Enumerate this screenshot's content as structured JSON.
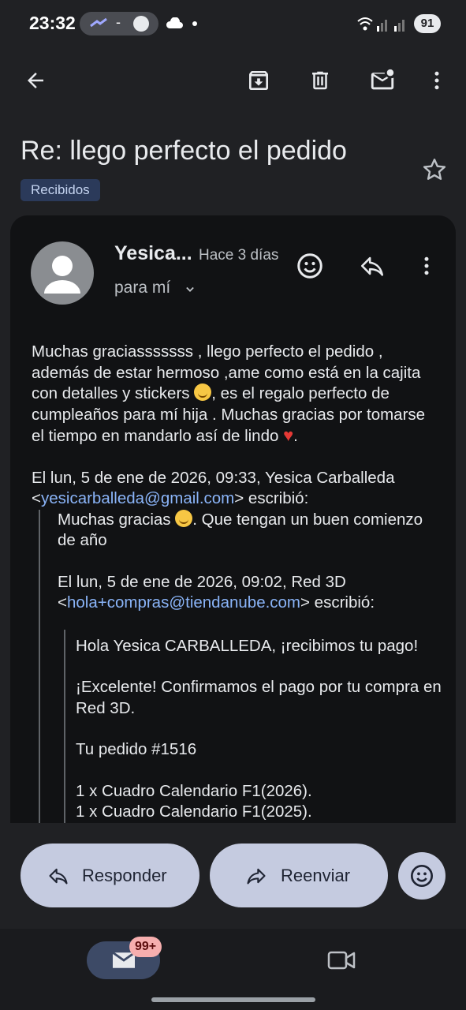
{
  "status": {
    "time": "23:32",
    "pill_dash": "-",
    "battery": "91"
  },
  "toolbar": {
    "back_icon": "arrow-back-icon",
    "archive_icon": "archive-icon",
    "delete_icon": "trash-icon",
    "unread_icon": "mark-unread-icon",
    "more_icon": "more-vert-icon"
  },
  "email": {
    "subject": "Re: llego perfecto el pedido",
    "label": "Recibidos",
    "sender": "Yesica...",
    "when": "Hace 3 días",
    "to": "para mí"
  },
  "body": {
    "para1_a": "Muchas graciasssssss , llego perfecto el pedido , además  de estar hermoso ,ame como está en la cajita con detalles y stickers ",
    "para1_b": ", es el regalo perfecto de cumpleaños  para mí hija . Muchas gracias por tomarse el tiempo en mandarlo así de lindo ",
    "para1_c": ".",
    "q1_header_a": "El lun, 5 de ene de 2026, 09:33, Yesica Carballeda <",
    "q1_email": "yesicarballeda@gmail.com",
    "q1_header_b": "> escribió:",
    "q1_text_a": "Muchas gracias ",
    "q1_text_b": ". Que tengan un buen comienzo de año",
    "q2_header_a": "El lun, 5 de ene de 2026, 09:02, Red 3D <",
    "q2_email": "hola+compras@tiendanube.com",
    "q2_header_b": "> escribió:",
    "q2_line1": "Hola Yesica CARBALLEDA, ¡recibimos tu pago!",
    "q2_line2": "¡Excelente! Confirmamos el pago por tu compra en Red 3D.",
    "q2_line3": "Tu pedido #1516",
    "q2_line4": "1 x Cuadro Calendario F1(2026).",
    "q2_line5": "1 x Cuadro Calendario F1(2025)."
  },
  "actions": {
    "reply": "Responder",
    "forward": "Reenviar"
  },
  "nav": {
    "badge": "99+"
  }
}
